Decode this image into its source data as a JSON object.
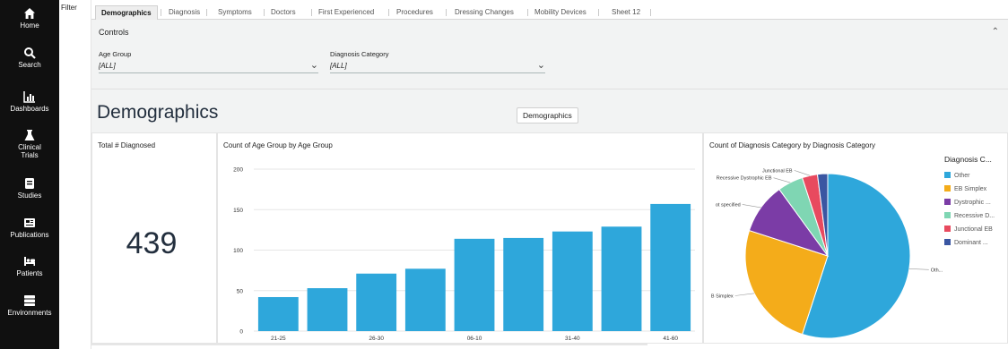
{
  "nav": [
    {
      "label": "Home",
      "icon": "home-icon"
    },
    {
      "label": "Search",
      "icon": "search-icon"
    },
    {
      "label": "Dashboards",
      "icon": "bar-chart-icon"
    },
    {
      "label": "Clinical Trials",
      "icon": "flask-icon"
    },
    {
      "label": "Studies",
      "icon": "book-icon"
    },
    {
      "label": "Publications",
      "icon": "newspaper-icon"
    },
    {
      "label": "Patients",
      "icon": "bed-icon"
    },
    {
      "label": "Environments",
      "icon": "server-icon"
    }
  ],
  "filter_label": "Filter",
  "tabs": [
    "Demographics",
    "Diagnosis",
    "Symptoms",
    "Doctors",
    "First Experienced",
    "Procedures",
    "Dressing Changes",
    "Mobility Devices",
    "Sheet 12"
  ],
  "controls": {
    "title": "Controls",
    "age_group": {
      "label": "Age Group",
      "value": "[ALL]"
    },
    "diagnosis_category": {
      "label": "Diagnosis Category",
      "value": "[ALL]"
    }
  },
  "page_title": "Demographics",
  "title_chip": "Demographics",
  "kpi": {
    "title": "Total # Diagnosed",
    "value": "439"
  },
  "bar_chart": {
    "title": "Count of Age Group by Age Group"
  },
  "pie_chart": {
    "title": "Count of Diagnosis Category by Diagnosis Category",
    "legend_title": "Diagnosis C..."
  },
  "chart_data": [
    {
      "type": "bar",
      "title": "Count of Age Group by Age Group",
      "categories": [
        "21-25",
        "",
        "26-30",
        "",
        "06-10",
        "",
        "31-40",
        "",
        "41-60"
      ],
      "values": [
        42,
        53,
        71,
        77,
        114,
        115,
        123,
        129,
        157
      ],
      "ylim": [
        0,
        200
      ],
      "yticks": [
        0,
        50,
        100,
        150,
        200
      ],
      "color": "#2ea7db",
      "grid": true
    },
    {
      "type": "pie",
      "title": "Count of Diagnosis Category by Diagnosis Category",
      "legend_title": "Diagnosis C...",
      "legend_position": "right",
      "labels": [
        "Other",
        "EB Simplex",
        "Dystrophic ...",
        "Recessive D...",
        "Junctional EB",
        "Dominant ..."
      ],
      "values": [
        55,
        25,
        10,
        5,
        3,
        2
      ],
      "colors": [
        "#2ea7db",
        "#f4ac1a",
        "#7b3ca6",
        "#7fd6b3",
        "#e84a5f",
        "#3a56a2"
      ],
      "slice_labels": [
        "Oth...",
        "B Simplex",
        "ot specified",
        "Recessive Dystrophic EB",
        "Junctional EB",
        ""
      ]
    }
  ]
}
